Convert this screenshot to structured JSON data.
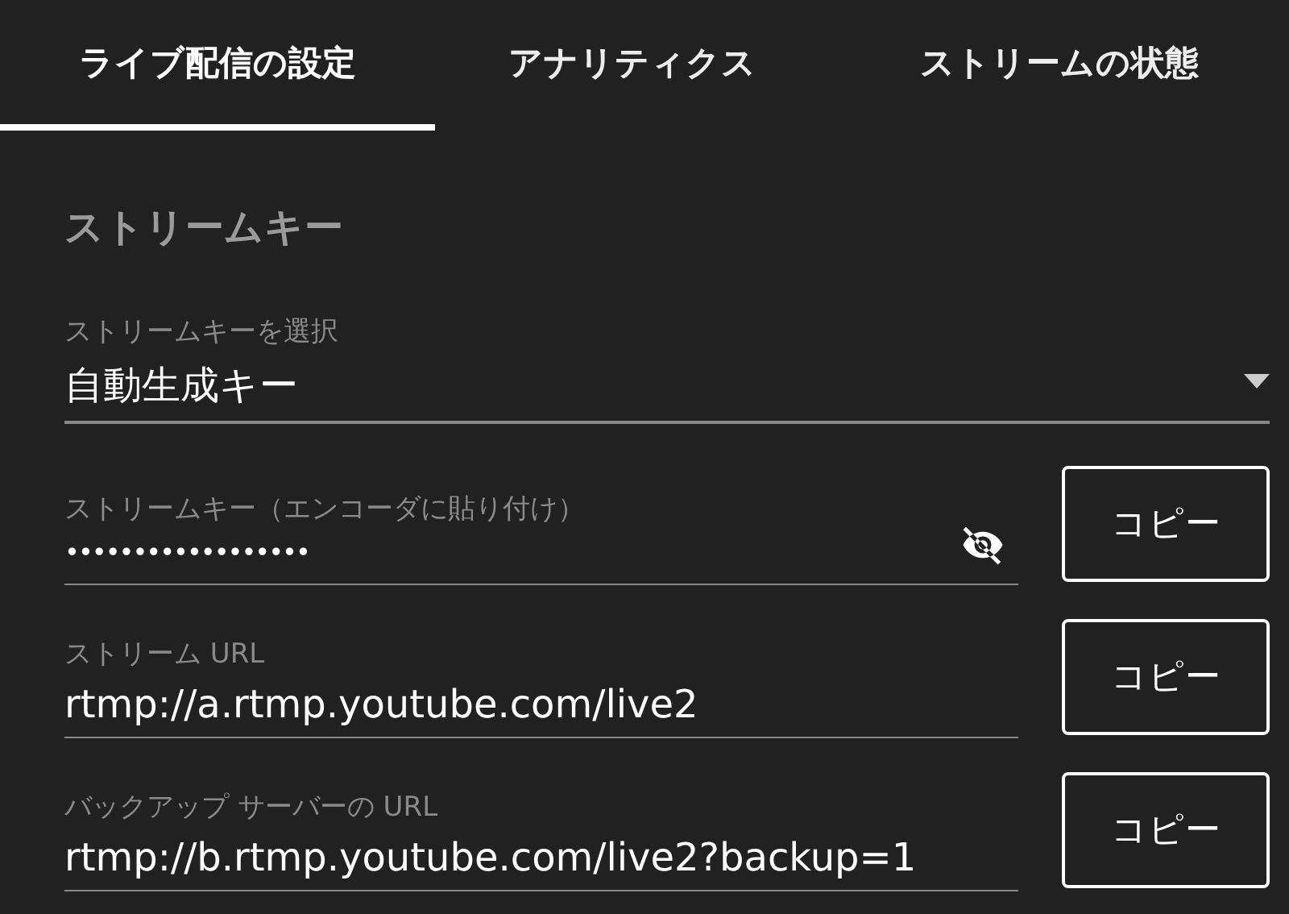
{
  "tabs": [
    {
      "label": "ライブ配信の設定",
      "selected": true
    },
    {
      "label": "アナリティクス",
      "selected": false
    },
    {
      "label": "ストリームの状態",
      "selected": false
    }
  ],
  "section_title": "ストリームキー",
  "select": {
    "label": "ストリームキーを選択",
    "value": "自動生成キー"
  },
  "fields": [
    {
      "kind": "secret",
      "label": "ストリームキー（エンコーダに貼り付け）",
      "value": "••••••••••••••••••",
      "revealed": false,
      "button": "コピー"
    },
    {
      "kind": "text",
      "label": "ストリーム URL",
      "value": "rtmp://a.rtmp.youtube.com/live2",
      "button": "コピー"
    },
    {
      "kind": "text",
      "label": "バックアップ サーバーの URL",
      "value": "rtmp://b.rtmp.youtube.com/live2?backup=1",
      "button": "コピー"
    }
  ]
}
